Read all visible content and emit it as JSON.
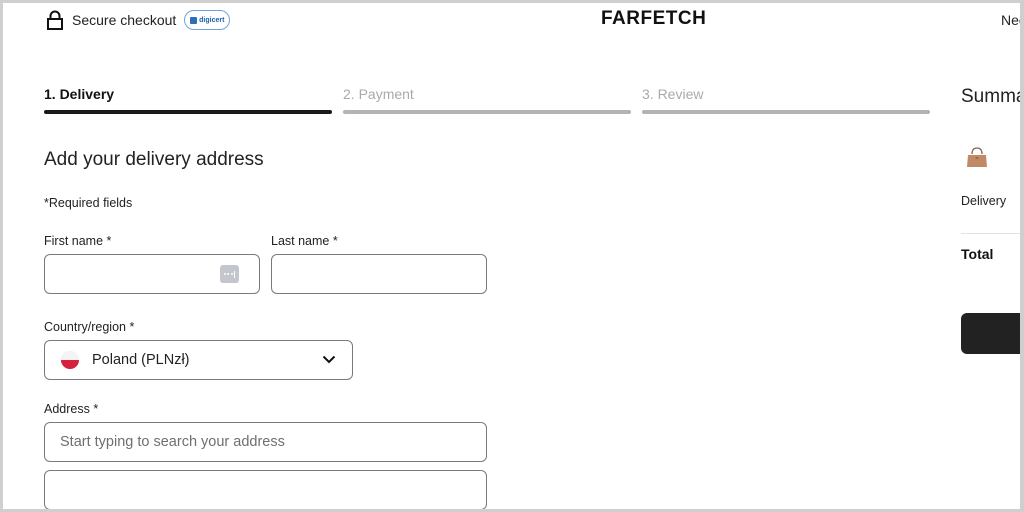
{
  "header": {
    "secure_label": "Secure checkout",
    "badge_text": "digicert",
    "logo": "FARFETCH",
    "help_text": "Nee"
  },
  "steps": [
    {
      "label": "1. Delivery",
      "active": true
    },
    {
      "label": "2. Payment",
      "active": false
    },
    {
      "label": "3. Review",
      "active": false
    }
  ],
  "form": {
    "heading": "Add your delivery address",
    "required_note": "*Required fields",
    "first_name": {
      "label": "First name *",
      "value": "",
      "placeholder": ""
    },
    "last_name": {
      "label": "Last name *",
      "value": "",
      "placeholder": ""
    },
    "country": {
      "label": "Country/region *",
      "value": "Poland (PLNzł)",
      "flag": "poland-flag"
    },
    "address": {
      "label": "Address *",
      "placeholder": "Start typing to search your address",
      "value": ""
    },
    "address_line2": {
      "value": "",
      "placeholder": ""
    }
  },
  "summary": {
    "title": "Summary",
    "item_icon": "handbag-icon",
    "delivery_label": "Delivery",
    "total_label": "Total"
  },
  "colors": {
    "active_step": "#1a1a1a",
    "inactive_step": "#b3b3b3",
    "button": "#222222"
  }
}
